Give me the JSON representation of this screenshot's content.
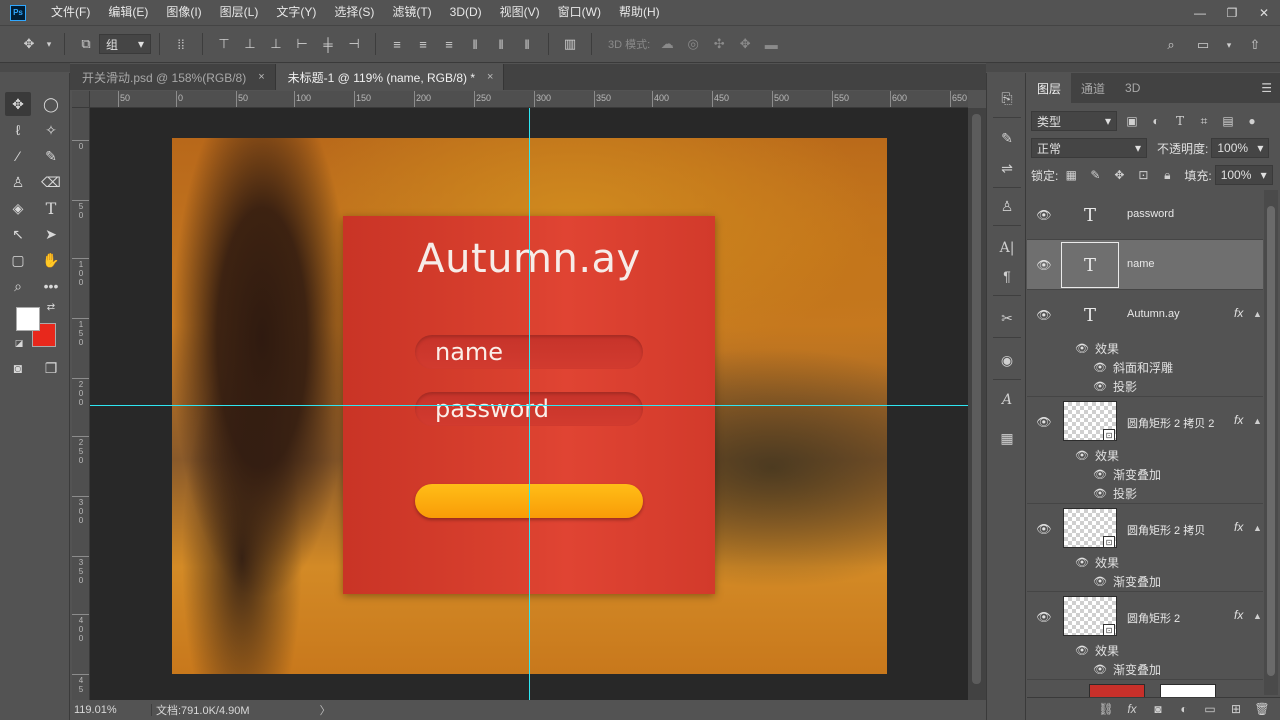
{
  "app": {
    "logo_text": "Ps",
    "menu": [
      "文件(F)",
      "编辑(E)",
      "图像(I)",
      "图层(L)",
      "文字(Y)",
      "选择(S)",
      "滤镜(T)",
      "3D(D)",
      "视图(V)",
      "窗口(W)",
      "帮助(H)"
    ]
  },
  "options_bar": {
    "auto_select_value": "组",
    "mode_3d_label": "3D 模式:"
  },
  "tabs": [
    {
      "label": "开关滑动.psd @ 158%(RGB/8)",
      "close": "×"
    },
    {
      "label": "未标题-1 @ 119% (name, RGB/8) *",
      "close": "×"
    }
  ],
  "rulers": {
    "h_labels": [
      "50",
      "0",
      "50",
      "100",
      "150",
      "200",
      "250",
      "300",
      "350",
      "400",
      "450",
      "500",
      "550",
      "600",
      "650"
    ],
    "v_labels": [
      "0",
      "5\n0",
      "1\n0\n0",
      "1\n5\n0",
      "2\n0\n0",
      "2\n5\n0",
      "3\n0\n0",
      "3\n5\n0",
      "4\n0\n0",
      "4\n5"
    ]
  },
  "document": {
    "card_title": "Autumn.ay",
    "field_name": "name",
    "field_password": "password"
  },
  "status": {
    "zoom": "119.01%",
    "doc_info": "文档:791.0K/4.90M",
    "arrow": "〉"
  },
  "layers_panel": {
    "tabs": [
      "图层",
      "通道",
      "3D"
    ],
    "filter_label": "类型",
    "blend_mode": "正常",
    "opacity_label": "不透明度:",
    "opacity_value": "100%",
    "lock_label": "锁定:",
    "fill_label": "填充:",
    "fill_value": "100%",
    "layers": [
      {
        "name": "password",
        "type": "text"
      },
      {
        "name": "name",
        "type": "text",
        "selected": true
      },
      {
        "name": "Autumn.ay",
        "type": "text",
        "fx": "fx",
        "effects_label": "效果",
        "effects": [
          "斜面和浮雕",
          "投影"
        ]
      },
      {
        "name": "圆角矩形 2 拷贝 2",
        "type": "shape",
        "fx": "fx",
        "effects_label": "效果",
        "effects": [
          "渐变叠加",
          "投影"
        ]
      },
      {
        "name": "圆角矩形 2 拷贝",
        "type": "shape",
        "fx": "fx",
        "effects_label": "效果",
        "effects": [
          "渐变叠加"
        ]
      },
      {
        "name": "圆角矩形 2",
        "type": "shape",
        "fx": "fx",
        "effects_label": "效果",
        "effects": [
          "渐变叠加"
        ]
      }
    ]
  },
  "colors": {
    "foreground": "#ffffff",
    "background": "#e8281c",
    "guide": "#2fe6f2",
    "card": "#d9402e",
    "button": "#fbad0e"
  }
}
